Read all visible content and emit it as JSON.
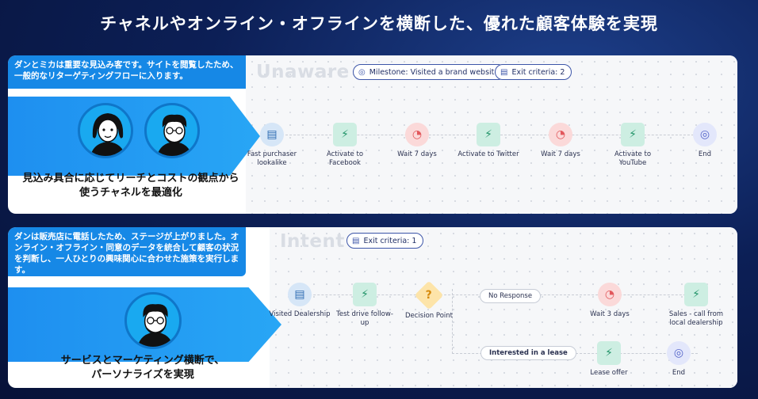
{
  "title": "チャネルやオンライン・オフラインを横断した、優れた顧客体験を実現",
  "colors": {
    "accent_blue": "#1688e6",
    "background_navy": "#0c1f56",
    "pill_border": "#3c55a8"
  },
  "panel1": {
    "intro": "ダンとミカは重要な見込み客です。サイトを閲覧したため、一般的なリターゲティングフローに入ります。",
    "caption_line1": "見込み具合に応じてリーチとコストの観点から",
    "caption_line2": "使うチャネルを最適化",
    "stage": "Unaware",
    "milestone": {
      "icon": "milestone-icon",
      "label": "Milestone: Visited a brand website"
    },
    "exit": {
      "icon": "exit-criteria-icon",
      "label": "Exit criteria: 2"
    },
    "nodes": [
      {
        "icon": "audience-icon",
        "label": "Fast purchaser lookalike"
      },
      {
        "icon": "activate-plug-icon",
        "label": "Activate to Facebook"
      },
      {
        "icon": "wait-clock-icon",
        "label": "Wait 7 days"
      },
      {
        "icon": "activate-plug-icon",
        "label": "Activate to Twitter"
      },
      {
        "icon": "wait-clock-icon",
        "label": "Wait 7 days"
      },
      {
        "icon": "activate-plug-icon",
        "label": "Activate to YouTube"
      },
      {
        "icon": "end-icon",
        "label": "End"
      }
    ]
  },
  "panel2": {
    "intro": "ダンは販売店に電話したため、ステージが上がりました。オンライン・オフライン・同意のデータを統合して顧客の状況を判断し、一人ひとりの興味関心に合わせた施策を実行します。",
    "caption_line1": "サービスとマーケティング横断で、",
    "caption_line2": "パーソナライズを実現",
    "stage": "Intent",
    "exit": {
      "icon": "exit-criteria-icon",
      "label": "Exit criteria: 1"
    },
    "nodes": {
      "visited": {
        "icon": "audience-icon",
        "label": "Visited Dealership"
      },
      "test_drive": {
        "icon": "activate-plug-icon",
        "label": "Test drive follow-up"
      },
      "decision": {
        "icon": "decision-question-icon",
        "label": "Decision Point",
        "glyph": "?"
      },
      "wait": {
        "icon": "wait-clock-icon",
        "label": "Wait 3 days"
      },
      "sales": {
        "icon": "activate-plug-icon",
        "label": "Sales - call from local dealership"
      },
      "lease": {
        "icon": "activate-plug-icon",
        "label": "Lease offer"
      },
      "end": {
        "icon": "end-icon",
        "label": "End"
      }
    },
    "branches": {
      "no_response": "No Response",
      "lease": "Interested in a lease"
    }
  }
}
